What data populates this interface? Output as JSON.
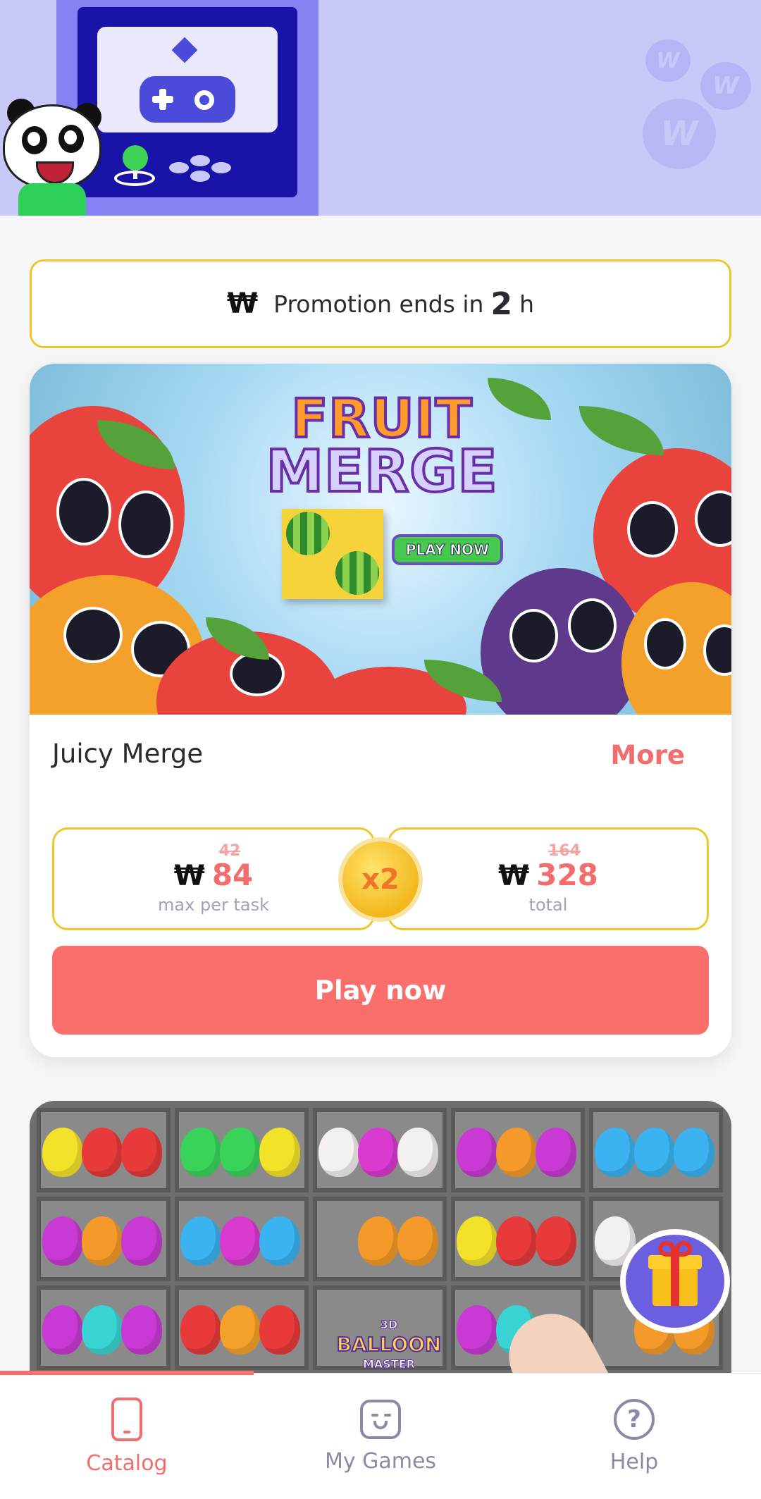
{
  "promo": {
    "currency_symbol": "₩",
    "text": "Promotion ends in",
    "hours": "2",
    "unit": "h"
  },
  "game": {
    "banner_title_line1": "FRUIT",
    "banner_title_line2": "MERGE",
    "banner_badge": "PLAY NOW",
    "title": "Juicy Merge",
    "more_label": "More",
    "max_per_task": {
      "currency_symbol": "₩",
      "old_value": "42",
      "value": "84",
      "caption": "max per task"
    },
    "multiplier": "x2",
    "total": {
      "currency_symbol": "₩",
      "old_value": "164",
      "value": "328",
      "caption": "total"
    },
    "play_label": "Play now"
  },
  "next_game": {
    "logo_small": "3D",
    "logo_line1": "BALLOON",
    "logo_line2": "MASTER"
  },
  "nav": {
    "items": [
      {
        "label": "Catalog",
        "icon": "phone-icon",
        "active": true
      },
      {
        "label": "My Games",
        "icon": "smiley-box-icon",
        "active": false
      },
      {
        "label": "Help",
        "icon": "question-circle-icon",
        "active": false
      }
    ]
  },
  "colors": {
    "accent": "#fa6f6b",
    "gold_border": "#f0c62e",
    "banner_bg": "#c9c9f9",
    "nav_inactive": "#8a8aa6"
  }
}
